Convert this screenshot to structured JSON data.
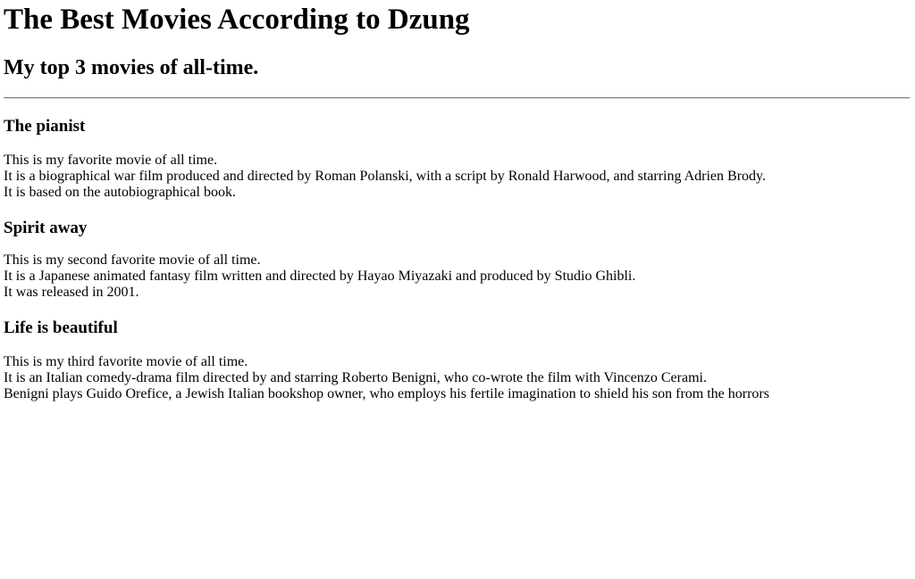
{
  "header": {
    "title": "The Best Movies According to Dzung",
    "subtitle": "My top 3 movies of all-time."
  },
  "movies": [
    {
      "title": "The pianist",
      "lines": [
        "This is my favorite movie of all time.",
        "It is a biographical war film produced and directed by Roman Polanski, with a script by Ronald Harwood, and starring Adrien Brody.",
        "It is based on the autobiographical book."
      ]
    },
    {
      "title": "Spirit away",
      "lines": [
        "This is my second favorite movie of all time.",
        "It is a Japanese animated fantasy film written and directed by Hayao Miyazaki and produced by Studio Ghibli.",
        "It was released in 2001."
      ]
    },
    {
      "title": "Life is beautiful",
      "lines": [
        "This is my third favorite movie of all time.",
        "It is an Italian comedy-drama film directed by and starring Roberto Benigni, who co-wrote the film with Vincenzo Cerami.",
        "Benigni plays Guido Orefice, a Jewish Italian bookshop owner, who employs his fertile imagination to shield his son from the horrors"
      ]
    }
  ]
}
